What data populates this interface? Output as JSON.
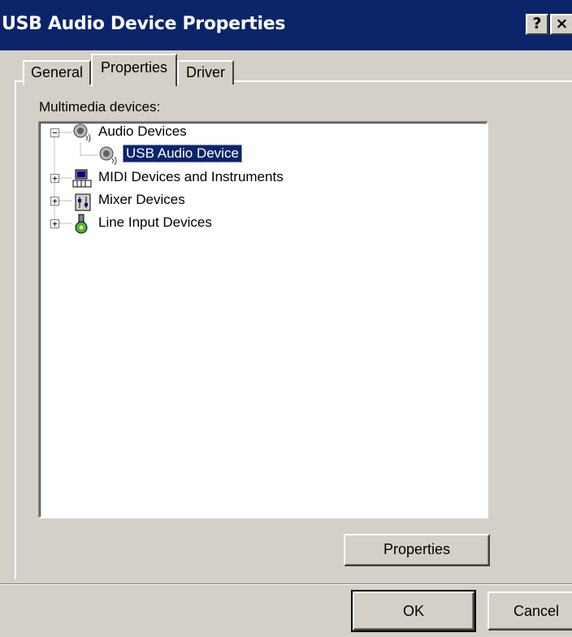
{
  "window": {
    "title": "USB Audio Device Properties",
    "help_label": "?",
    "close_label": "×"
  },
  "tabs": [
    {
      "label": "General"
    },
    {
      "label": "Properties"
    },
    {
      "label": "Driver"
    }
  ],
  "active_tab": "Properties",
  "multimedia": {
    "label": "Multimedia devices:",
    "tree": [
      {
        "label": "Audio Devices",
        "expanded": true,
        "icon": "speaker-icon",
        "children": [
          {
            "label": "USB Audio Device",
            "icon": "speaker-icon",
            "selected": true
          }
        ]
      },
      {
        "label": "MIDI Devices and Instruments",
        "expanded": false,
        "icon": "midi-keyboard-icon"
      },
      {
        "label": "Mixer Devices",
        "expanded": false,
        "icon": "mixer-icon"
      },
      {
        "label": "Line Input Devices",
        "expanded": false,
        "icon": "line-input-icon"
      }
    ]
  },
  "buttons": {
    "properties": "Properties",
    "ok": "OK",
    "cancel": "Cancel"
  },
  "colors": {
    "titlebar": "#0a246a",
    "selection": "#0a246a",
    "face": "#d4d0c8"
  }
}
